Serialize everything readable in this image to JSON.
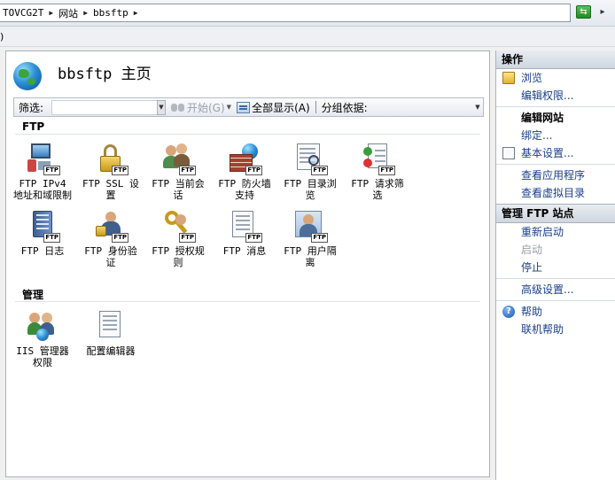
{
  "address_bar": {
    "segments": [
      "TOVCG2T",
      "网站",
      "bbsftp"
    ],
    "refresh_icon": "refresh-icon"
  },
  "menubar": {
    "partial": ")"
  },
  "page": {
    "title": "bbsftp 主页"
  },
  "filterbar": {
    "label": "筛选:",
    "input_value": "",
    "start_label": "开始(G)",
    "show_all_label": "全部显示(A)",
    "group_by_label": "分组依据:"
  },
  "groups": {
    "ftp": {
      "header": "FTP",
      "features": [
        {
          "label": "FTP IPv4 地址和域限制",
          "icon": "ip-restrictions-icon"
        },
        {
          "label": "FTP SSL 设置",
          "icon": "lock-icon"
        },
        {
          "label": "FTP 当前会话",
          "icon": "sessions-icon"
        },
        {
          "label": "FTP 防火墙支持",
          "icon": "firewall-icon"
        },
        {
          "label": "FTP 目录浏览",
          "icon": "directory-browsing-icon"
        },
        {
          "label": "FTP 请求筛选",
          "icon": "request-filtering-icon"
        },
        {
          "label": "FTP 日志",
          "icon": "log-icon"
        },
        {
          "label": "FTP 身份验证",
          "icon": "authentication-icon"
        },
        {
          "label": "FTP 授权规则",
          "icon": "authorization-key-icon"
        },
        {
          "label": "FTP 消息",
          "icon": "messages-icon"
        },
        {
          "label": "FTP 用户隔离",
          "icon": "user-isolation-icon"
        }
      ]
    },
    "manage": {
      "header": "管理",
      "features": [
        {
          "label": "IIS 管理器权限",
          "icon": "manager-permissions-icon"
        },
        {
          "label": "配置编辑器",
          "icon": "config-editor-icon"
        }
      ]
    }
  },
  "actions": {
    "header": "操作",
    "items_1": [
      {
        "label": "浏览",
        "icon": "folder-icon"
      },
      {
        "label": "编辑权限...",
        "icon": ""
      }
    ],
    "items_2": [
      {
        "label": "编辑网站",
        "icon": ""
      },
      {
        "label": "绑定...",
        "icon": ""
      },
      {
        "label": "基本设置...",
        "icon": "settings-icon"
      }
    ],
    "items_3": [
      {
        "label": "查看应用程序",
        "icon": ""
      },
      {
        "label": "查看虚拟目录",
        "icon": ""
      }
    ],
    "manage_header": "管理 FTP 站点",
    "items_4": [
      {
        "label": "重新启动",
        "icon": ""
      },
      {
        "label": "启动",
        "icon": ""
      },
      {
        "label": "停止",
        "icon": ""
      }
    ],
    "items_5": [
      {
        "label": "高级设置...",
        "icon": ""
      }
    ],
    "items_6": [
      {
        "label": "帮助",
        "icon": "help-icon"
      },
      {
        "label": "联机帮助",
        "icon": ""
      }
    ]
  }
}
